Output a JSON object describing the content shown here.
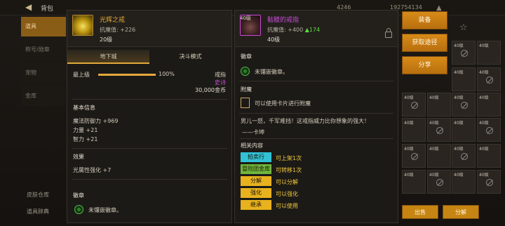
{
  "header": {
    "title": "背包",
    "currency_a": "4246",
    "currency_b": "192754134"
  },
  "leftnav": {
    "items": [
      "道具",
      "称号/勋章",
      "宠物",
      "金库"
    ],
    "foot": [
      "皮肤仓库",
      "道具辞典"
    ]
  },
  "itemA": {
    "name": "光辉之戒",
    "stat_label": "抗魔值",
    "stat_value": ": +226",
    "level": "20级",
    "tabs": [
      "地下城",
      "决斗模式"
    ],
    "upgrade_label": "最上级",
    "upgrade_percent": "100%",
    "upgrade_fraction": 1.0,
    "type": "戒指",
    "rarity": "史诗",
    "price": "30,000金币",
    "basic_title": "基本信息",
    "basic_lines": [
      "魔法防御力 +969",
      "力量 +21",
      "智力 +21"
    ],
    "effect_title": "效果",
    "effect_line": "光属性强化 +7",
    "emblem_title": "徽章",
    "emblem_text": "未镶嵌徽章。"
  },
  "itemB": {
    "name": "骷髅的戒指",
    "badge": "40级",
    "stat_label": "抗魔值",
    "stat_value": ": +400",
    "stat_delta": "▲174",
    "level": "40级",
    "emblem_title": "徽章",
    "emblem_text": "未镶嵌徽章。",
    "enchant_title": "附魔",
    "enchant_text": "可以使用卡片进行附魔",
    "flavor_1": "男儿一怒，千军难挡！这戒指威力比你想象的强大！",
    "flavor_2": "——卡坤",
    "related_title": "相关内容",
    "related": [
      {
        "tag": "拍卖行",
        "text": "可上架1次",
        "color": "#31c2d6"
      },
      {
        "tag": "冒险团金库",
        "text": "可转移1次",
        "color": "#6fb63b"
      },
      {
        "tag": "分解",
        "text": "可以分解",
        "color": "#e8b21f"
      },
      {
        "tag": "强化",
        "text": "可以强化",
        "color": "#e8b21f"
      },
      {
        "tag": "继承",
        "text": "可以使用",
        "color": "#e8b21f"
      }
    ]
  },
  "actions": {
    "equip": "装备",
    "obtain": "获取途径",
    "share": "分享"
  },
  "bottom_actions": {
    "sell": "出售",
    "disassemble": "分解"
  },
  "slots": {
    "level_label": "40级"
  },
  "colors": {
    "legendary": "#e0a83a",
    "epic": "#c94bd6",
    "positive": "#5fdd3f",
    "accent": "#d88b18"
  }
}
